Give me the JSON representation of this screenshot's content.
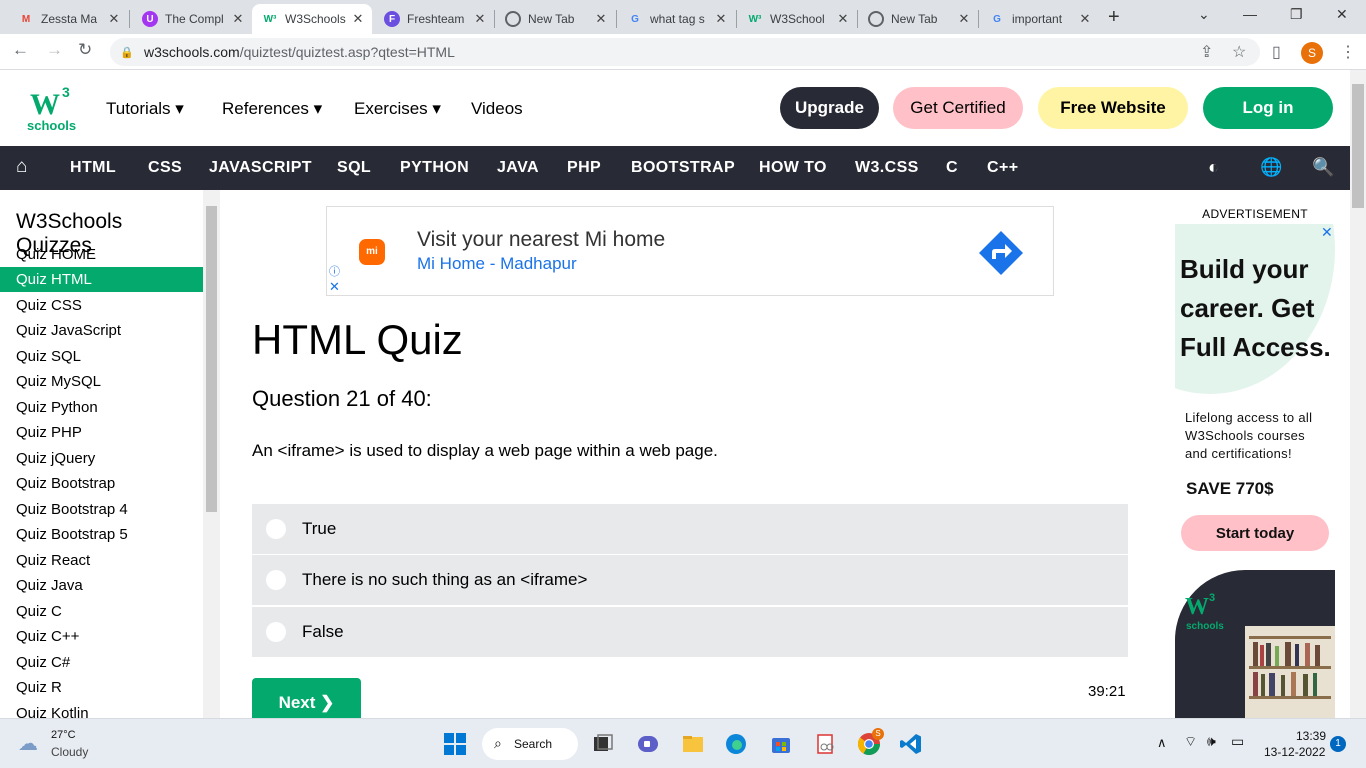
{
  "browser": {
    "tabs": [
      {
        "title": "Zessta Ma",
        "icon": "gmail-icon",
        "close": "✕",
        "active": false
      },
      {
        "title": "The Compl",
        "icon": "udemy-icon",
        "close": "✕",
        "active": false
      },
      {
        "title": "W3Schools",
        "icon": "w3schools-icon",
        "close": "✕",
        "active": true
      },
      {
        "title": "Freshteam",
        "icon": "freshteam-icon",
        "close": "✕",
        "active": false
      },
      {
        "title": "New Tab",
        "icon": "chrome-icon",
        "close": "✕",
        "active": false
      },
      {
        "title": "what tag s",
        "icon": "google-icon",
        "close": "✕",
        "active": false
      },
      {
        "title": "W3School",
        "icon": "w3schools-icon",
        "close": "✕",
        "active": false
      },
      {
        "title": "New Tab",
        "icon": "chrome-icon",
        "close": "✕",
        "active": false
      },
      {
        "title": "important",
        "icon": "google-icon",
        "close": "✕",
        "active": false
      }
    ],
    "new_tab": "+",
    "window_controls": [
      "⌄",
      "—",
      "❐",
      "✕"
    ],
    "url_host": "w3schools.com",
    "url_path": "/quiztest/quiztest.asp?qtest=HTML",
    "profile_initial": "S"
  },
  "site": {
    "logo_letter": "W",
    "logo_sup": "3",
    "logo_text": "schools",
    "nav": [
      {
        "label": "Tutorials ▾"
      },
      {
        "label": "References ▾"
      },
      {
        "label": "Exercises ▾"
      },
      {
        "label": "Videos"
      }
    ],
    "upgrade": "Upgrade",
    "get_certified": "Get Certified",
    "free_website": "Free Website",
    "login": "Log in",
    "topics": [
      {
        "label": "HTML"
      },
      {
        "label": "CSS"
      },
      {
        "label": "JAVASCRIPT"
      },
      {
        "label": "SQL"
      },
      {
        "label": "PYTHON"
      },
      {
        "label": "JAVA"
      },
      {
        "label": "PHP"
      },
      {
        "label": "BOOTSTRAP"
      },
      {
        "label": "HOW TO"
      },
      {
        "label": "W3.CSS"
      },
      {
        "label": "C"
      },
      {
        "label": "C++"
      }
    ]
  },
  "sidebar": {
    "heading": "W3Schools Quizzes",
    "items": [
      {
        "label": "Quiz HOME",
        "selected": false
      },
      {
        "label": "Quiz HTML",
        "selected": true
      },
      {
        "label": "Quiz CSS",
        "selected": false
      },
      {
        "label": "Quiz JavaScript",
        "selected": false
      },
      {
        "label": "Quiz SQL",
        "selected": false
      },
      {
        "label": "Quiz MySQL",
        "selected": false
      },
      {
        "label": "Quiz Python",
        "selected": false
      },
      {
        "label": "Quiz PHP",
        "selected": false
      },
      {
        "label": "Quiz jQuery",
        "selected": false
      },
      {
        "label": "Quiz Bootstrap",
        "selected": false
      },
      {
        "label": "Quiz Bootstrap 4",
        "selected": false
      },
      {
        "label": "Quiz Bootstrap 5",
        "selected": false
      },
      {
        "label": "Quiz React",
        "selected": false
      },
      {
        "label": "Quiz Java",
        "selected": false
      },
      {
        "label": "Quiz C",
        "selected": false
      },
      {
        "label": "Quiz C++",
        "selected": false
      },
      {
        "label": "Quiz C#",
        "selected": false
      },
      {
        "label": "Quiz R",
        "selected": false
      },
      {
        "label": "Quiz Kotlin",
        "selected": false
      }
    ]
  },
  "ad_banner": {
    "logo": "mi",
    "line1": "Visit your nearest Mi home",
    "line2": "Mi Home - Madhapur",
    "info": "ⓘ",
    "close": "✕"
  },
  "quiz": {
    "title": "HTML Quiz",
    "question_number": "Question 21 of 40:",
    "question": "An <iframe> is used to display a web page within a web page.",
    "options": [
      {
        "label": "True",
        "selected": false
      },
      {
        "label": "There is no such thing as an <iframe>",
        "selected": false
      },
      {
        "label": "False",
        "selected": false
      }
    ],
    "next": "Next ❯",
    "timer": "39:21"
  },
  "right_ad": {
    "label": "ADVERTISEMENT",
    "close": "✕",
    "headline": "Build your career. Get Full Access.",
    "body": "Lifelong access to all W3Schools courses and certifications!",
    "save": "SAVE 770$",
    "cta": "Start today",
    "logo_letter": "W",
    "logo_sup": "3",
    "logo_text": "schools"
  },
  "taskbar": {
    "weather_temp": "27°C",
    "weather_desc": "Cloudy",
    "search": "Search",
    "time": "13:39",
    "date": "13-12-2022",
    "notification_count": "1",
    "chrome_badge": "S"
  },
  "colors": {
    "w3_green": "#04aa6d",
    "dark_nav": "#282a35",
    "certified_pink": "#ffc0c7",
    "website_yellow": "#fff4a3"
  }
}
